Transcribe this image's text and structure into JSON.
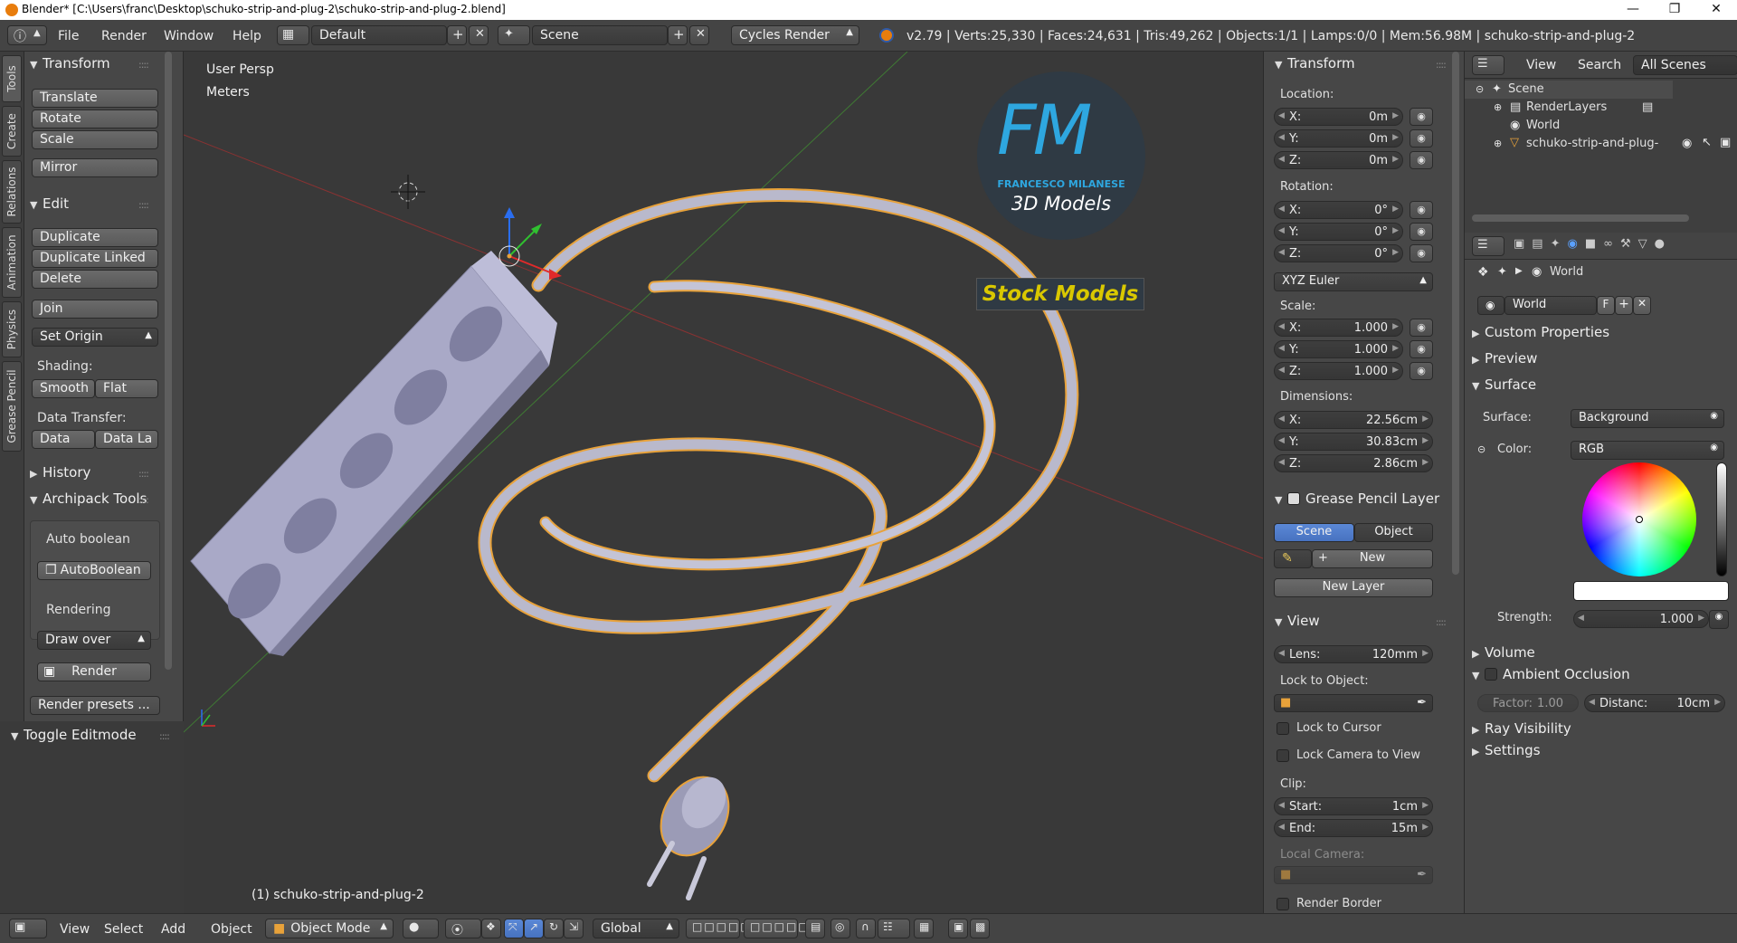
{
  "window": {
    "title": "Blender* [C:\\Users\\franc\\Desktop\\schuko-strip-and-plug-2\\schuko-strip-and-plug-2.blend]",
    "min_icon": "minimize-icon",
    "max_icon": "maximize-icon",
    "close_icon": "close-icon"
  },
  "infobar": {
    "menus": [
      "File",
      "Render",
      "Window",
      "Help"
    ],
    "layout": "Default",
    "scene": "Scene",
    "engine": "Cycles Render",
    "stats": "v2.79 | Verts:25,330 | Faces:24,631 | Tris:49,262 | Objects:1/1 | Lamps:0/0 | Mem:56.98M | schuko-strip-and-plug-2"
  },
  "vtabs": [
    "Tools",
    "Create",
    "Relations",
    "Animation",
    "Physics",
    "Grease Pencil"
  ],
  "toolshelf": {
    "transform_title": "Transform",
    "translate": "Translate",
    "rotate": "Rotate",
    "scale": "Scale",
    "mirror": "Mirror",
    "edit_title": "Edit",
    "duplicate": "Duplicate",
    "duplicate_linked": "Duplicate Linked",
    "delete": "Delete",
    "join": "Join",
    "set_origin": "Set Origin",
    "shading_label": "Shading:",
    "smooth": "Smooth",
    "flat": "Flat",
    "data_transfer_label": "Data Transfer:",
    "data": "Data",
    "data_la": "Data La",
    "history_title": "History",
    "archipack_title": "Archipack Tools",
    "auto_boolean_label": "Auto boolean",
    "autoboolean_btn": "AutoBoolean",
    "rendering_label": "Rendering",
    "draw_over": "Draw over",
    "render_btn": "Render",
    "render_presets": "Render presets ...",
    "toggle_editmode": "Toggle Editmode"
  },
  "viewport": {
    "view_name": "User Persp",
    "units": "Meters",
    "object_label": "(1) schuko-strip-and-plug-2",
    "logo_letters": "FM",
    "logo_name": "FRANCESCO MILANESE",
    "logo_sub": "3D Models",
    "logo_banner": "Stock Models"
  },
  "npanel": {
    "transform_title": "Transform",
    "location_label": "Location:",
    "loc": [
      {
        "k": "X:",
        "v": "0m"
      },
      {
        "k": "Y:",
        "v": "0m"
      },
      {
        "k": "Z:",
        "v": "0m"
      }
    ],
    "rotation_label": "Rotation:",
    "rot": [
      {
        "k": "X:",
        "v": "0°"
      },
      {
        "k": "Y:",
        "v": "0°"
      },
      {
        "k": "Z:",
        "v": "0°"
      }
    ],
    "rot_mode": "XYZ Euler",
    "scale_label": "Scale:",
    "scl": [
      {
        "k": "X:",
        "v": "1.000"
      },
      {
        "k": "Y:",
        "v": "1.000"
      },
      {
        "k": "Z:",
        "v": "1.000"
      }
    ],
    "dimensions_label": "Dimensions:",
    "dim": [
      {
        "k": "X:",
        "v": "22.56cm"
      },
      {
        "k": "Y:",
        "v": "30.83cm"
      },
      {
        "k": "Z:",
        "v": "2.86cm"
      }
    ],
    "gp_title": "Grease Pencil Layer",
    "gp_scene": "Scene",
    "gp_object": "Object",
    "gp_new": "New",
    "gp_new_layer": "New Layer",
    "view_title": "View",
    "lens_label": "Lens:",
    "lens_value": "120mm",
    "lock_to_object": "Lock to Object:",
    "lock_to_cursor": "Lock to Cursor",
    "lock_camera": "Lock Camera to View",
    "clip_label": "Clip:",
    "clip_start_k": "Start:",
    "clip_start_v": "1cm",
    "clip_end_k": "End:",
    "clip_end_v": "15m",
    "local_camera": "Local Camera:",
    "render_border": "Render Border"
  },
  "outliner": {
    "view": "View",
    "search": "Search",
    "scope": "All Scenes",
    "items": [
      "Scene",
      "RenderLayers",
      "World",
      "schuko-strip-and-plug-"
    ]
  },
  "properties": {
    "context": "World",
    "world_name": "World",
    "world_f": "F",
    "custom_properties": "Custom Properties",
    "preview": "Preview",
    "surface_title": "Surface",
    "surface_label": "Surface:",
    "surface_value": "Background",
    "color_label": "Color:",
    "color_value": "RGB",
    "strength_label": "Strength:",
    "strength_value": "1.000",
    "volume": "Volume",
    "ambient_occlusion": "Ambient Occlusion",
    "factor_k": "Factor:",
    "factor_v": "1.00",
    "distance_k": "Distanc:",
    "distance_v": "10cm",
    "ray_visibility": "Ray Visibility",
    "settings": "Settings"
  },
  "bottombar": {
    "menus": [
      "View",
      "Select",
      "Add",
      "Object"
    ],
    "mode": "Object Mode",
    "orientation": "Global"
  },
  "colors": {
    "accent_blue": "#5680c2",
    "logo_blue": "#2ea7e0",
    "logo_yellow": "#d9c800",
    "selection_orange": "#e8a23a"
  }
}
